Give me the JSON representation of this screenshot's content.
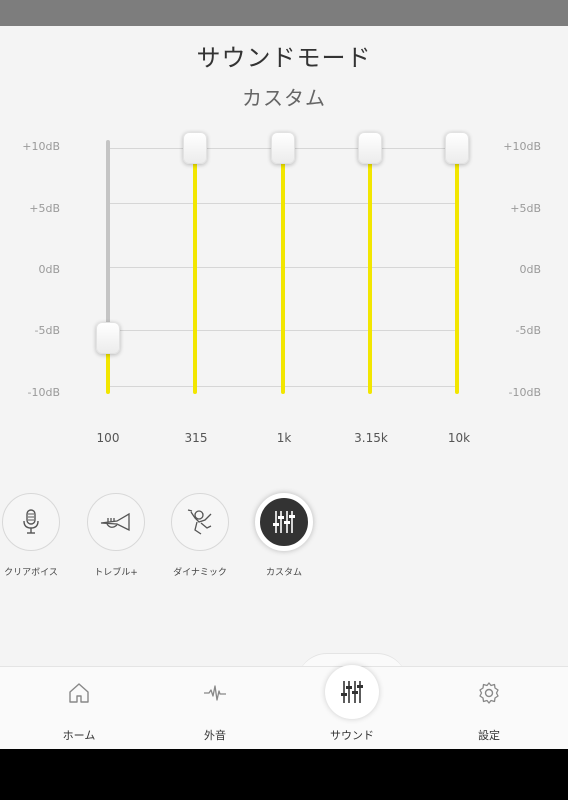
{
  "header": {
    "title": "サウンドモード",
    "subtitle": "カスタム"
  },
  "equalizer": {
    "db_labels": [
      "+10dB",
      "+5dB",
      "0dB",
      "-5dB",
      "-10dB"
    ],
    "bands": [
      {
        "label": "100",
        "level_db": -6
      },
      {
        "label": "315",
        "level_db": 10
      },
      {
        "label": "1k",
        "level_db": 10
      },
      {
        "label": "3.15k",
        "level_db": 10
      },
      {
        "label": "10k",
        "level_db": 10
      }
    ],
    "range_db": [
      -10,
      10
    ],
    "colors": {
      "active_track": "#f2e600",
      "inactive_track": "#c4c4c4"
    }
  },
  "modes": [
    {
      "label": "クリアボイス",
      "icon": "microphone-icon",
      "active": false
    },
    {
      "label": "トレブル+",
      "icon": "trumpet-icon",
      "active": false
    },
    {
      "label": "ダイナミック",
      "icon": "dynamic-person-icon",
      "active": false
    },
    {
      "label": "カスタム",
      "icon": "sliders-icon",
      "active": true
    }
  ],
  "tabbar": {
    "items": [
      {
        "label": "ホーム",
        "icon": "home-icon"
      },
      {
        "label": "外音",
        "icon": "waveform-icon"
      },
      {
        "label": "サウンド",
        "icon": "sliders-icon"
      },
      {
        "label": "設定",
        "icon": "gear-icon"
      }
    ],
    "active": "サウンド"
  }
}
